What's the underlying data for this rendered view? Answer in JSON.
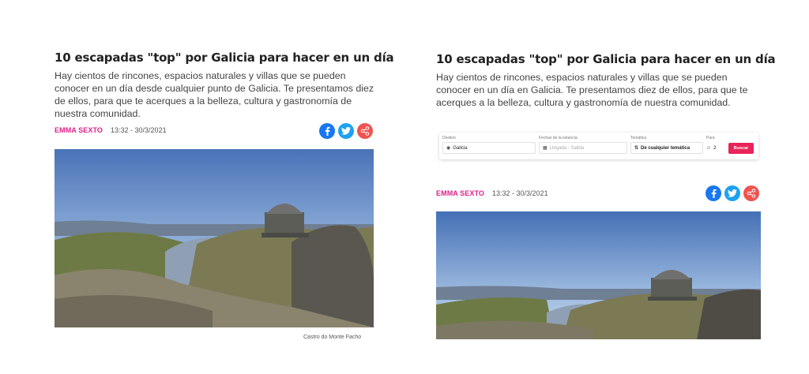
{
  "left": {
    "title": "10 escapadas \"top\" por Galicia para hacer en un día",
    "intro": "Hay cientos de rincones, espacios naturales y villas que se pueden conocer en un día desde cualquier punto de Galicia. Te presentamos diez de ellos, para que te acerques a la belleza, cultura y gastronomía de nuestra comunidad.",
    "author": "EMMA SEXTO",
    "date": "13:32 - 30/3/2021",
    "caption": "Castro do Monte Facho"
  },
  "right": {
    "title": "10 escapadas \"top\" por Galicia para hacer en un día",
    "intro": "Hay cientos de rincones, espacios naturales y villas que se pueden conocer en un día en Galicia. Te presentamos diez de ellos, para que te acerques a la belleza, cultura y gastronomía de nuestra comunidad.",
    "author": "EMMA SEXTO",
    "date": "13:32 - 30/3/2021"
  },
  "search_bar": {
    "destino_label": "Destino",
    "destino_value": "Galicia",
    "fechas_label": "Fechas de la estancia",
    "fechas_placeholder": "Llegada - Salida",
    "tematica_label": "Temática",
    "tematica_value": "De cualquier temática",
    "para_label": "Para",
    "para_value": "2",
    "buscar_label": "Buscar"
  },
  "icons": {
    "facebook": "facebook-icon",
    "twitter": "twitter-icon",
    "share": "share-icon",
    "location": "location-pin-icon",
    "calendar": "calendar-icon",
    "filter": "filter-icon",
    "people": "people-icon"
  },
  "colors": {
    "author": "#e0218a",
    "facebook": "#1877f2",
    "twitter": "#1da1f2",
    "share": "#ef5350",
    "button": "#e8245a"
  }
}
